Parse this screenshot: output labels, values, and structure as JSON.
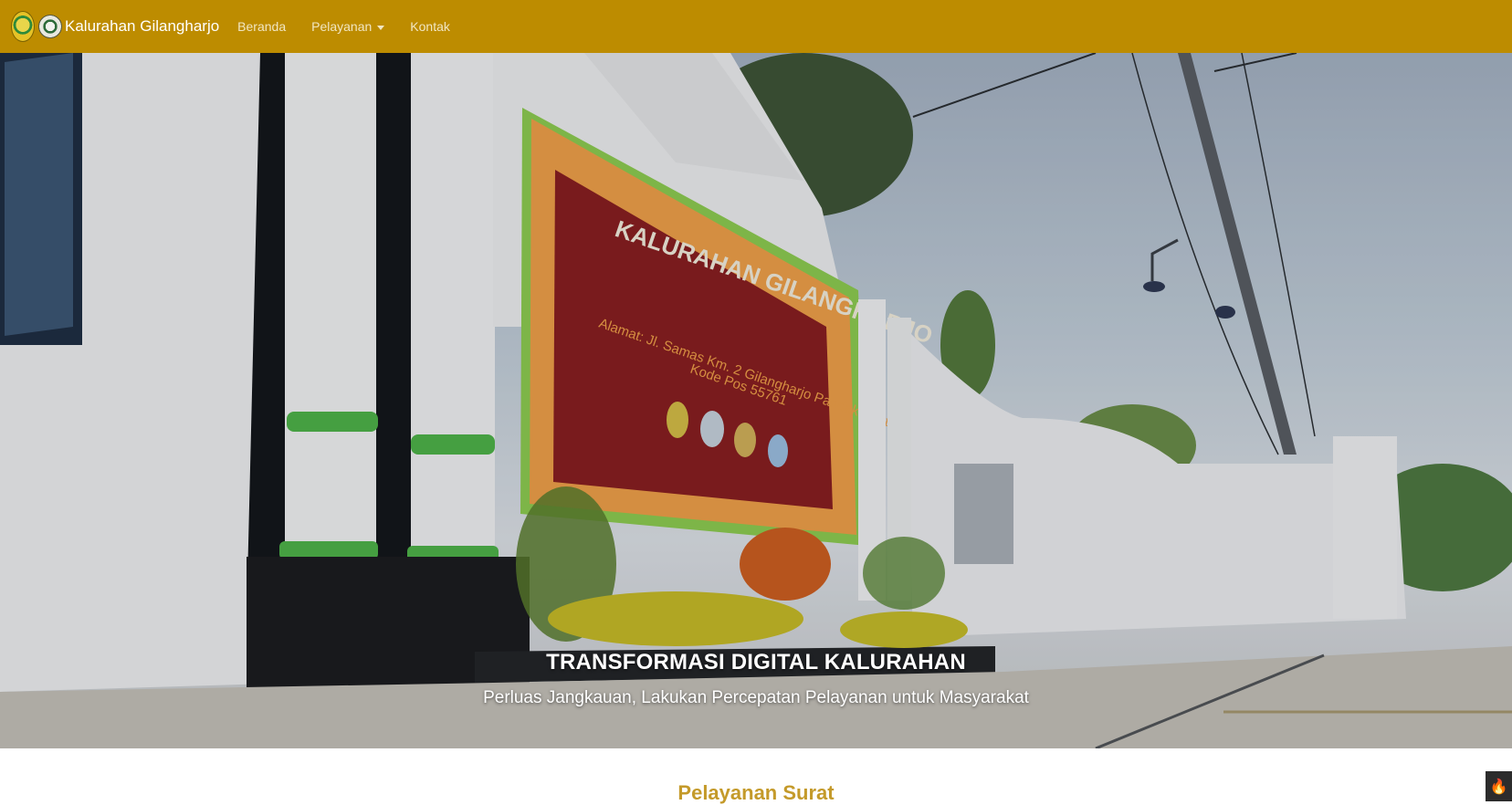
{
  "navbar": {
    "brand": "Kalurahan Gilangharjo",
    "links": [
      {
        "label": "Beranda"
      },
      {
        "label": "Pelayanan"
      },
      {
        "label": "Kontak"
      }
    ],
    "background_color": "#bd8c00"
  },
  "hero": {
    "title": "TRANSFORMASI DIGITAL KALURAHAN",
    "subtitle": "Perluas Jangkauan, Lakukan Percepatan Pelayanan untuk Masyarakat",
    "sign": {
      "heading": "KALURAHAN GILANGHARJO",
      "address": "Alamat: Jl. Samas Km. 2 Gilangharjo Pandak Bantul",
      "postal": "Kode Pos 55761"
    }
  },
  "section": {
    "title": "Pelayanan Surat"
  },
  "icons": {
    "logo_left": "regency-emblem-icon",
    "logo_right": "village-seal-icon",
    "dropdown": "caret-down-icon",
    "floating_button": "fire-icon"
  }
}
